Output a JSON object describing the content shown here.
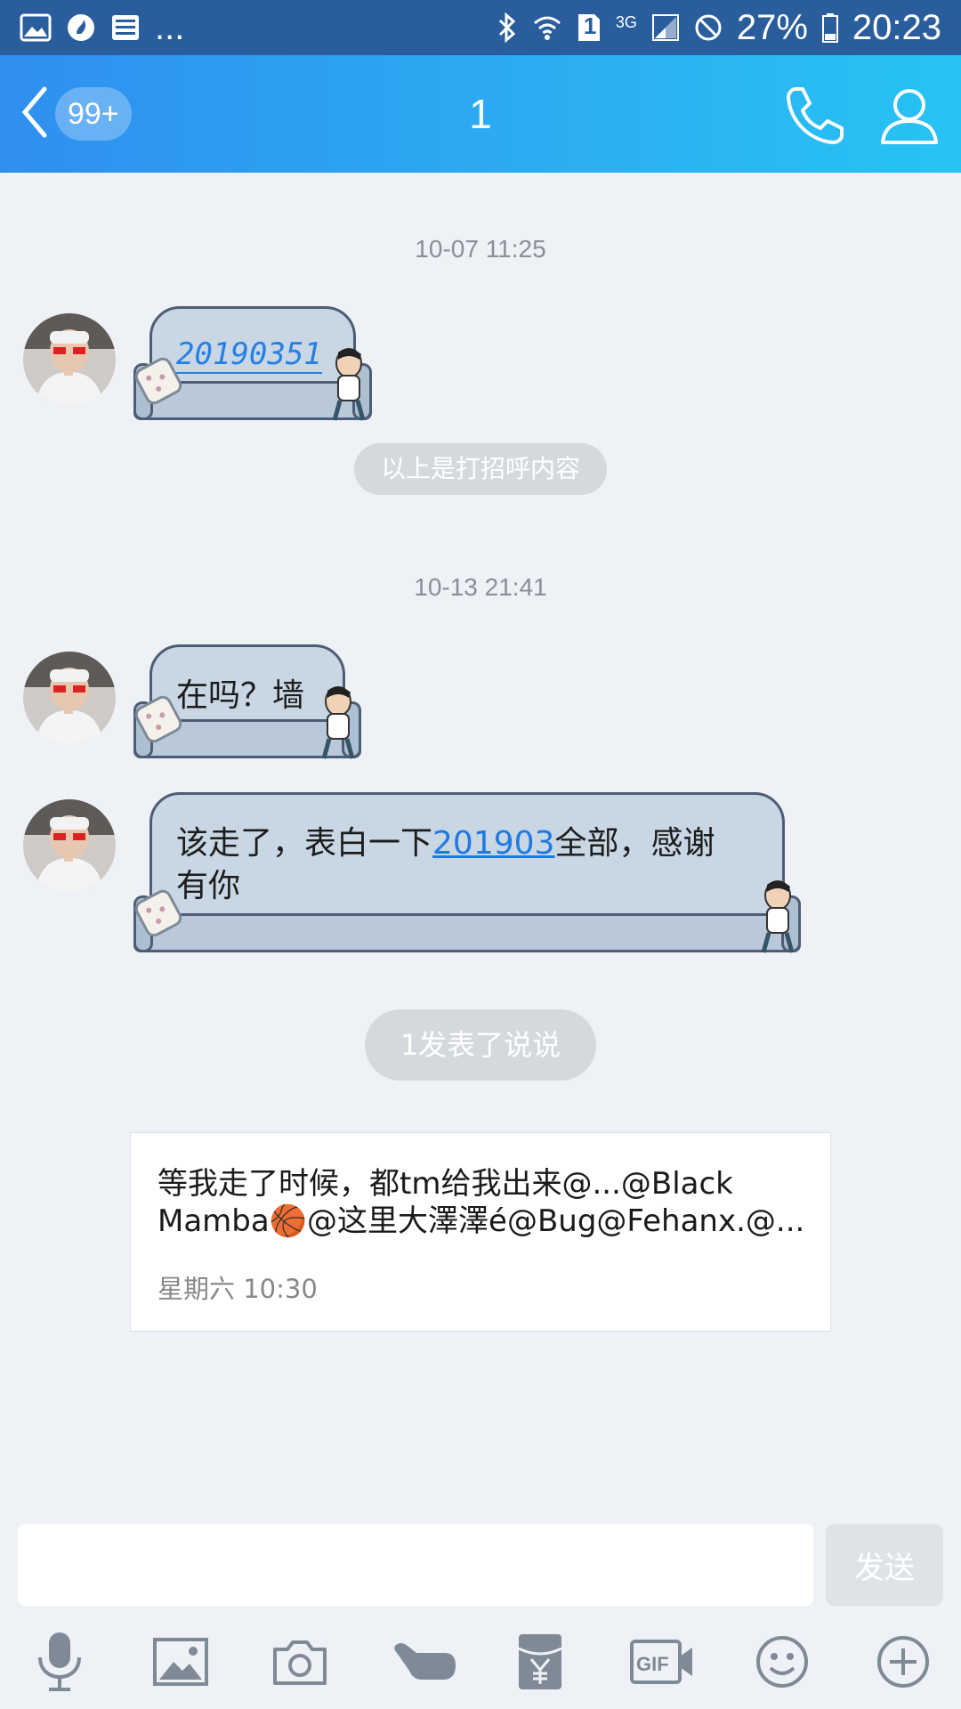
{
  "status_bar": {
    "overflow": "...",
    "sim_label": "1",
    "network": "3G",
    "battery": "27%",
    "time": "20:23"
  },
  "header": {
    "unread_badge": "99+",
    "title": "1"
  },
  "messages": {
    "timestamp_1": "10-07 11:25",
    "msg_1_text": "20190351",
    "greeting_notice": "以上是打招呼内容",
    "timestamp_2": "10-13 21:41",
    "msg_2_text": "在吗？墙",
    "msg_3_prefix": "该走了，表白一下",
    "msg_3_link": "201903",
    "msg_3_suffix": "全部，感谢有你",
    "post_notice": "1发表了说说"
  },
  "post_card": {
    "text": "等我走了时候，都tm给我出来@...@Black Mamba🏀@这里大澤澤é@Bug@Fehanx.@...",
    "time": "星期六 10:30"
  },
  "input": {
    "value": "",
    "send_label": "发送"
  },
  "toolbar": {
    "icons": [
      "microphone-icon",
      "image-icon",
      "camera-icon",
      "poke-icon",
      "red-packet-icon",
      "gif-icon",
      "emoji-icon",
      "plus-icon"
    ]
  },
  "colors": {
    "header_start": "#2f8fef",
    "header_end": "#28c3f4",
    "status_bar": "#2a5d9c",
    "background": "#eef1f6",
    "link": "#1f7ae0"
  }
}
